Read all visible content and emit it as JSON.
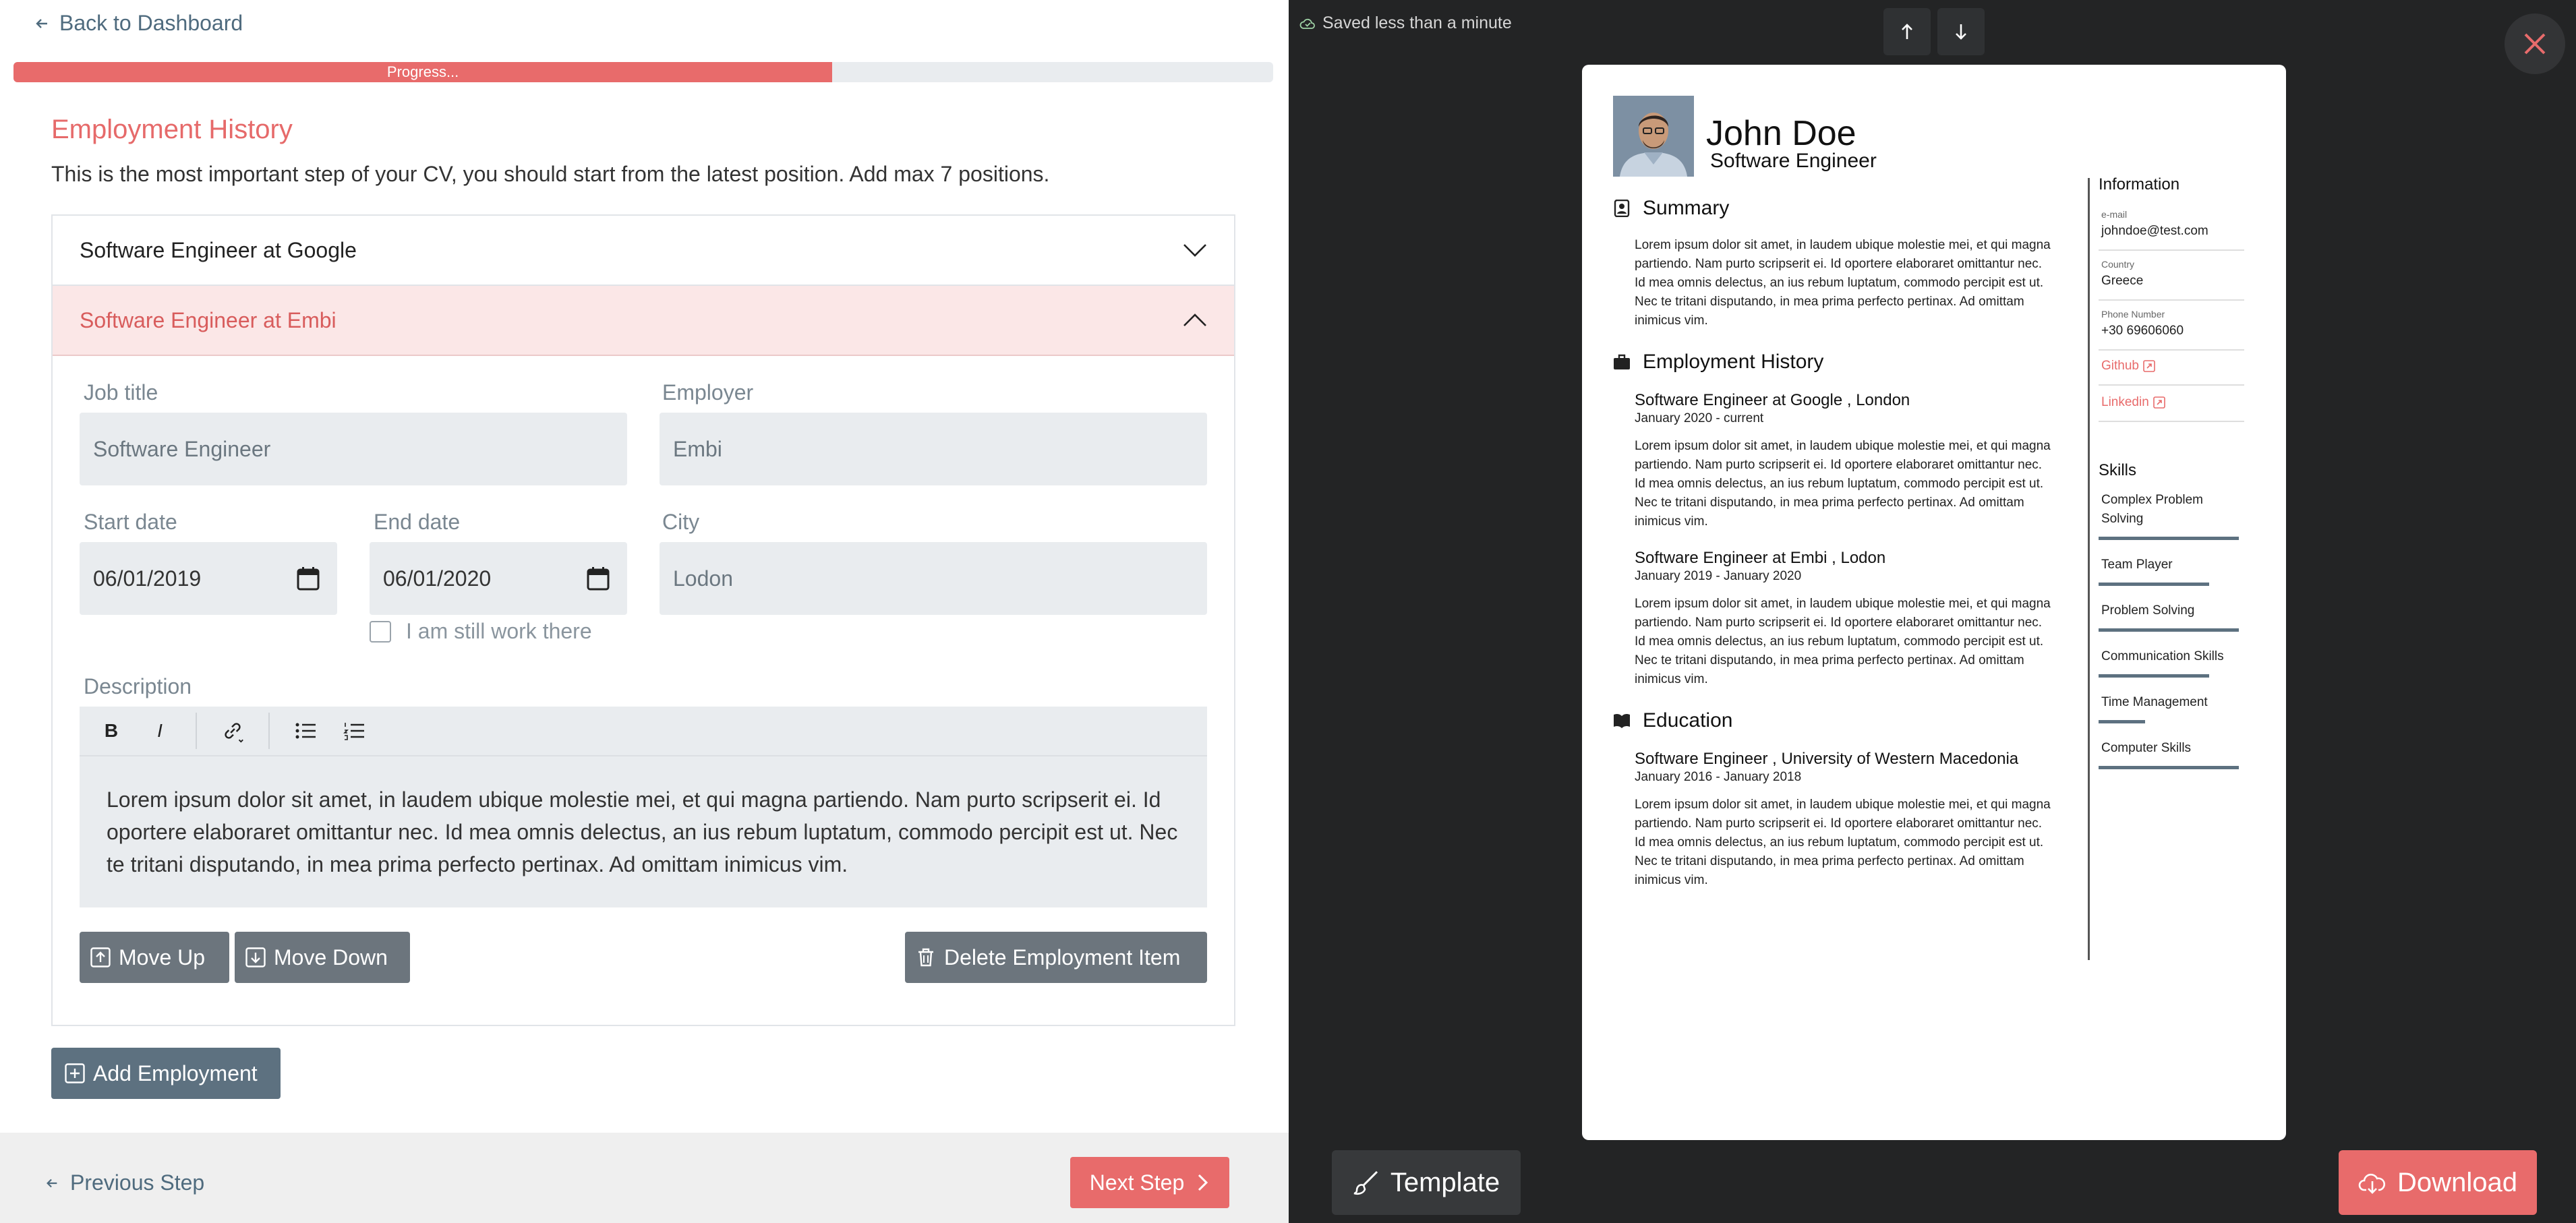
{
  "editor": {
    "back_label": "Back to Dashboard",
    "progress": {
      "label": "Progress...",
      "percent": 65
    },
    "section_title": "Employment History",
    "section_desc": "This is the most important step of your CV, you should start from the latest position. Add max 7 positions.",
    "items": [
      {
        "label": "Software Engineer at Google",
        "expanded": false
      },
      {
        "label": "Software Engineer at Embi",
        "expanded": true
      }
    ],
    "form": {
      "job_title_label": "Job title",
      "job_title_value": "Software Engineer",
      "employer_label": "Employer",
      "employer_value": "Embi",
      "start_label": "Start date",
      "start_value": "06/01/2019",
      "end_label": "End date",
      "end_value": "06/01/2020",
      "city_label": "City",
      "city_value": "Lodon",
      "still_work_label": "I am still work there",
      "description_label": "Description",
      "toolbar": {
        "bold": "B",
        "italic": "I"
      },
      "description_value": "Lorem ipsum dolor sit amet, in laudem ubique molestie mei, et qui magna partiendo. Nam purto scripserit ei. Id oportere elaboraret omittantur nec. Id mea omnis delectus, an ius rebum luptatum, commodo percipit est ut. Nec te tritani disputando, in mea prima perfecto pertinax. Ad omittam inimicus vim.",
      "move_up_label": "Move Up",
      "move_down_label": "Move Down",
      "delete_label": "Delete Employment Item"
    },
    "add_label": "Add Employment",
    "prev_label": "Previous Step",
    "next_label": "Next Step"
  },
  "preview": {
    "saved_text": "Saved less than a minute",
    "template_label": "Template",
    "download_label": "Download",
    "cv": {
      "name": "John Doe",
      "title": "Software Engineer",
      "summary_title": "Summary",
      "summary_text": "Lorem ipsum dolor sit amet, in laudem ubique molestie mei, et qui magna partiendo. Nam purto scripserit ei. Id oportere elaboraret omittantur nec. Id mea omnis delectus, an ius rebum luptatum, commodo percipit est ut. Nec te tritani disputando, in mea prima perfecto pertinax. Ad omittam inimicus vim.",
      "employment_title": "Employment History",
      "jobs": [
        {
          "role": "Software Engineer at Google , London",
          "dates": "January 2020 - current",
          "text": "Lorem ipsum dolor sit amet, in laudem ubique molestie mei, et qui magna partiendo. Nam purto scripserit ei. Id oportere elaboraret omittantur nec. Id mea omnis delectus, an ius rebum luptatum, commodo percipit est ut. Nec te tritani disputando, in mea prima perfecto pertinax. Ad omittam inimicus vim."
        },
        {
          "role": "Software Engineer at Embi , Lodon",
          "dates": "January 2019 - January 2020",
          "text": "Lorem ipsum dolor sit amet, in laudem ubique molestie mei, et qui magna partiendo. Nam purto scripserit ei. Id oportere elaboraret omittantur nec. Id mea omnis delectus, an ius rebum luptatum, commodo percipit est ut. Nec te tritani disputando, in mea prima perfecto pertinax. Ad omittam inimicus vim."
        }
      ],
      "education_title": "Education",
      "education": [
        {
          "role": "Software Engineer , University of Western Macedonia",
          "dates": "January 2016 - January 2018",
          "text": "Lorem ipsum dolor sit amet, in laudem ubique molestie mei, et qui magna partiendo. Nam purto scripserit ei. Id oportere elaboraret omittantur nec. Id mea omnis delectus, an ius rebum luptatum, commodo percipit est ut. Nec te tritani disputando, in mea prima perfecto pertinax. Ad omittam inimicus vim."
        }
      ],
      "info_title": "Information",
      "email_label": "e-mail",
      "email": "johndoe@test.com",
      "country_label": "Country",
      "country": "Greece",
      "phone_label": "Phone Number",
      "phone": "+30 69606060",
      "github": "Github",
      "linkedin": "Linkedin",
      "skills_title": "Skills",
      "skills": [
        {
          "name": "Complex Problem Solving",
          "level": 1.0
        },
        {
          "name": "Team Player",
          "level": 0.79
        },
        {
          "name": "Problem Solving",
          "level": 1.0
        },
        {
          "name": "Communication Skills",
          "level": 0.79
        },
        {
          "name": "Time Management",
          "level": 0.33
        },
        {
          "name": "Computer Skills",
          "level": 1.0
        }
      ]
    }
  },
  "colors": {
    "accent": "#e86b6b",
    "slate": "#5d7180",
    "dark": "#232425"
  }
}
